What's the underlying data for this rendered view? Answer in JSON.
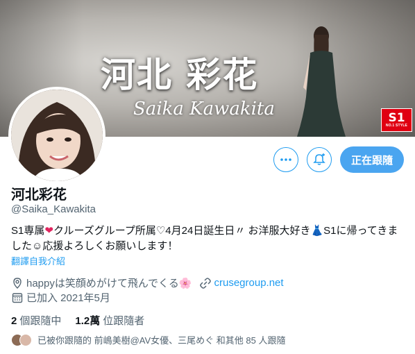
{
  "banner": {
    "title": "河北 彩花",
    "subtitle": "Saika Kawakita",
    "logo": {
      "main": "S1",
      "sub": "NO.1 STYLE",
      "color": "#e00012"
    }
  },
  "actions": {
    "more_icon": "more-horizontal-icon",
    "bell_icon": "bell-plus-icon",
    "follow_label": "正在跟隨",
    "accent": "#1d9bf0"
  },
  "profile": {
    "name": "河北彩花",
    "handle": "@Saika_Kawakita",
    "bio": {
      "part1": "S1専属",
      "part2": "クルーズグループ所属♡4月24日誕生日〃 お洋服大好き",
      "part3": "S1に帰ってきました☺応援よろしくお願いします！",
      "heart_glyph": "❤",
      "dress_glyph": "👗"
    },
    "translate_label": "翻譯自我介紹",
    "location": "happyは笑顔めがけて飛んでくる🌸",
    "website": "crusegroup.net",
    "joined": "已加入 2021年5月"
  },
  "stats": {
    "following_count": "2",
    "following_label": "個跟隨中",
    "followers_count": "1.2萬",
    "followers_label": "位跟隨者"
  },
  "followers_you_know": {
    "text": "已被你跟隨的 前嶋美樹@AV女優、三尾めぐ 和其他 85 人跟隨"
  }
}
